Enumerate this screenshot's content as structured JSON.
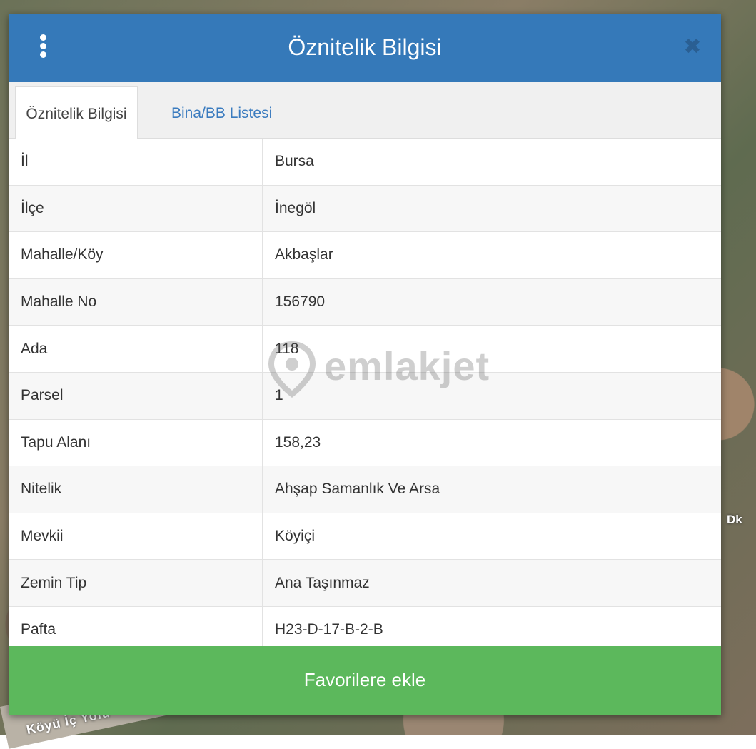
{
  "dialog": {
    "title": "Öznitelik Bilgisi",
    "close_symbol": "✖",
    "menu_icon": "vertical-ellipsis-icon"
  },
  "tabs": [
    {
      "label": "Öznitelik Bilgisi",
      "active": true
    },
    {
      "label": "Bina/BB Listesi",
      "active": false
    }
  ],
  "rows": [
    {
      "label": "İl",
      "value": "Bursa"
    },
    {
      "label": "İlçe",
      "value": "İnegöl"
    },
    {
      "label": "Mahalle/Köy",
      "value": "Akbaşlar"
    },
    {
      "label": "Mahalle No",
      "value": "156790"
    },
    {
      "label": "Ada",
      "value": "118"
    },
    {
      "label": "Parsel",
      "value": "1"
    },
    {
      "label": "Tapu Alanı",
      "value": "158,23"
    },
    {
      "label": "Nitelik",
      "value": "Ahşap Samanlık Ve Arsa"
    },
    {
      "label": "Mevkii",
      "value": "Köyiçi"
    },
    {
      "label": "Zemin Tip",
      "value": "Ana Taşınmaz"
    },
    {
      "label": "Pafta",
      "value": "H23-D-17-B-2-B"
    }
  ],
  "footer": {
    "button_label": "Favorilere ekle"
  },
  "watermark": {
    "text": "emlakjet"
  },
  "map": {
    "road_label": "Köyü İç Yolu",
    "edge_label": "Dk"
  },
  "colors": {
    "header": "#3579b9",
    "footer_button": "#5cb85c",
    "tab_link": "#3a7bbf"
  }
}
